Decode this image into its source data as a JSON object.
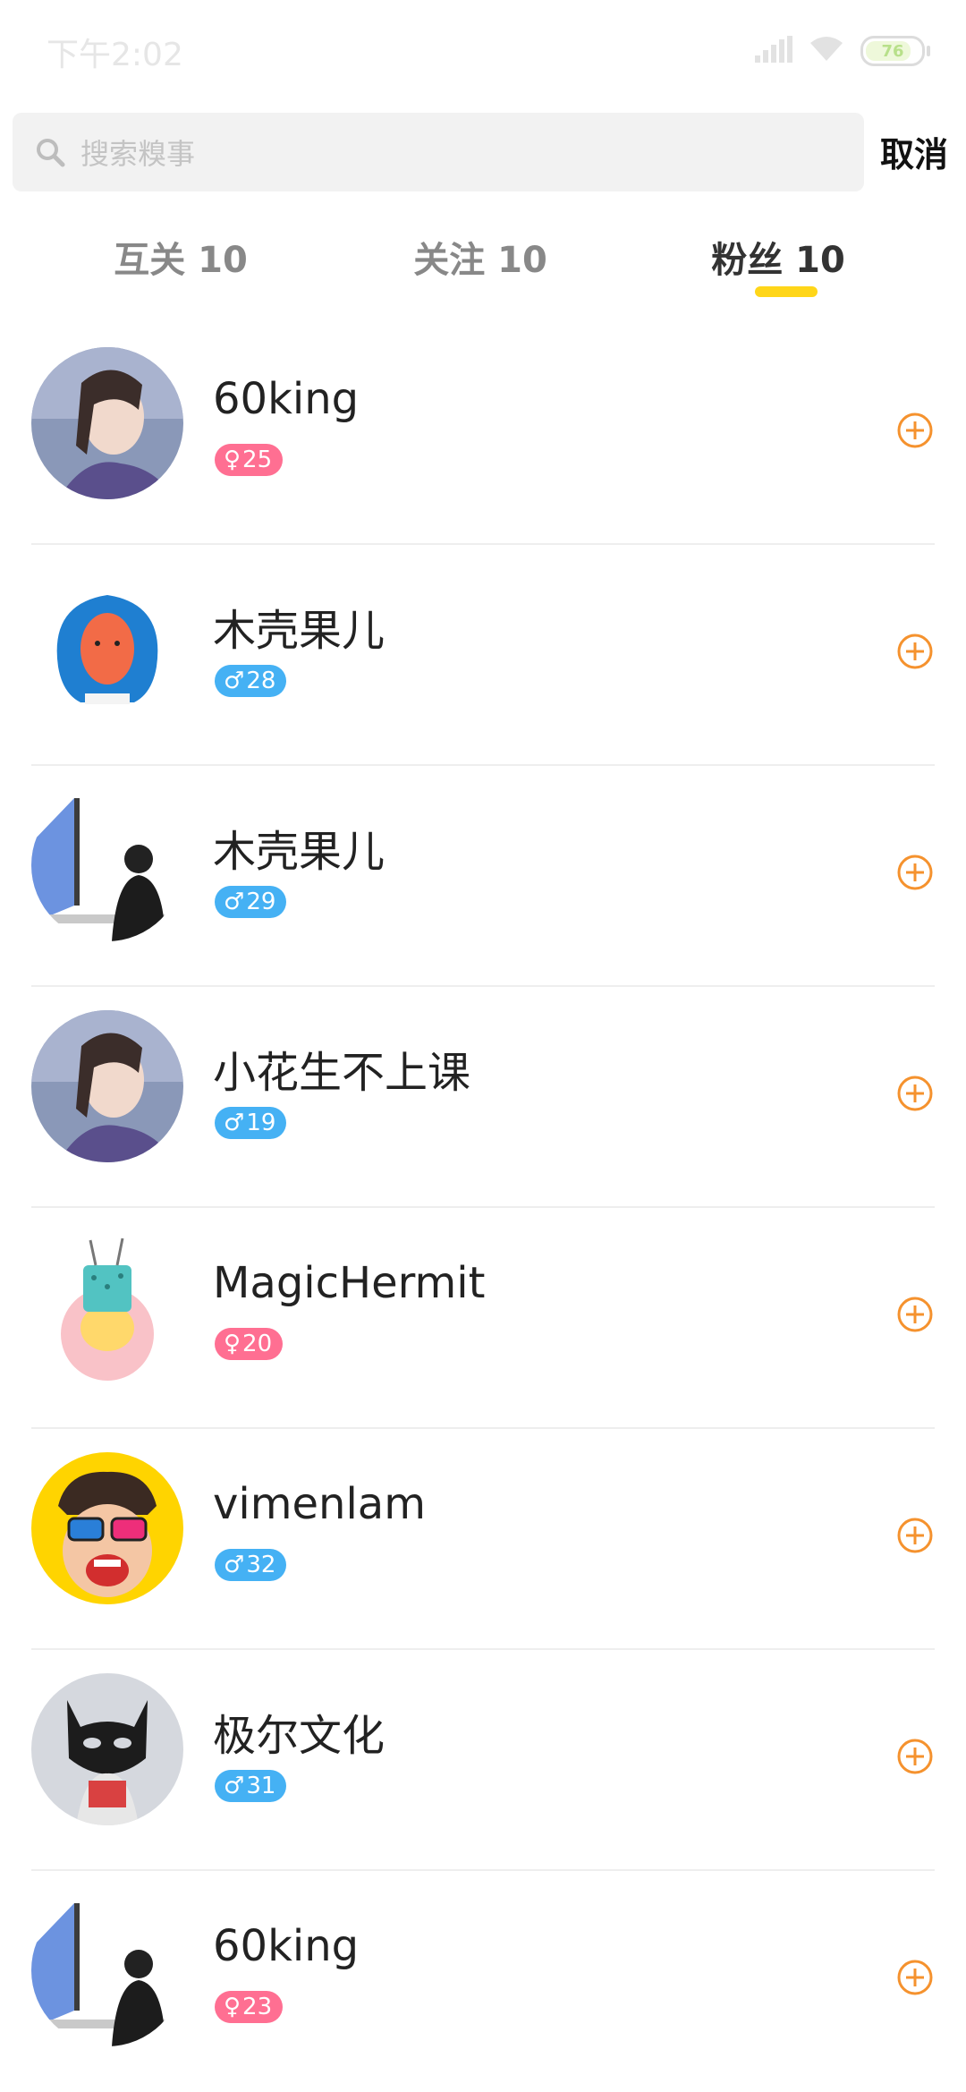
{
  "status_bar": {
    "time": "下午2:02",
    "battery": "76"
  },
  "search": {
    "placeholder": "搜索糗事",
    "cancel_label": "取消"
  },
  "tabs": [
    {
      "label": "互关 10",
      "active": false
    },
    {
      "label": "关注 10",
      "active": false
    },
    {
      "label": "粉丝 10",
      "active": true
    }
  ],
  "colors": {
    "accent_yellow": "#ffd619",
    "follow_orange": "#f5922e",
    "female_badge": "#ff6f92",
    "male_badge": "#45b1f4"
  },
  "users": [
    {
      "name": "60king",
      "gender": "female",
      "gender_symbol": "♀",
      "age": "25",
      "follow_icon": "plus-circle-icon"
    },
    {
      "name": "木壳果儿",
      "gender": "male",
      "gender_symbol": "♂",
      "age": "28",
      "follow_icon": "plus-circle-icon"
    },
    {
      "name": "木壳果儿",
      "gender": "male",
      "gender_symbol": "♂",
      "age": "29",
      "follow_icon": "plus-circle-icon"
    },
    {
      "name": "小花生不上课",
      "gender": "male",
      "gender_symbol": "♂",
      "age": "19",
      "follow_icon": "plus-circle-icon"
    },
    {
      "name": "MagicHermit",
      "gender": "female",
      "gender_symbol": "♀",
      "age": "20",
      "follow_icon": "plus-circle-icon"
    },
    {
      "name": "vimenlam",
      "gender": "male",
      "gender_symbol": "♂",
      "age": "32",
      "follow_icon": "plus-circle-icon"
    },
    {
      "name": "极尔文化",
      "gender": "male",
      "gender_symbol": "♂",
      "age": "31",
      "follow_icon": "plus-circle-icon"
    },
    {
      "name": "60king",
      "gender": "female",
      "gender_symbol": "♀",
      "age": "23",
      "follow_icon": "plus-circle-icon"
    }
  ]
}
